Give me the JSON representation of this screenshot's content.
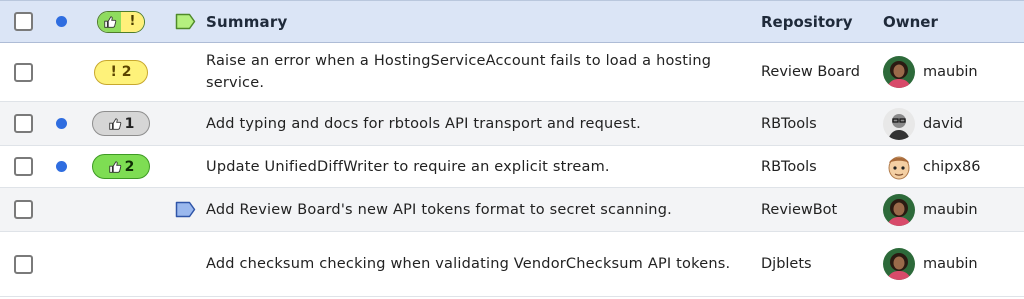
{
  "header": {
    "summary": "Summary",
    "repository": "Repository",
    "owner": "Owner",
    "ship_it_issue_mark": "!"
  },
  "rows": [
    {
      "new_updates": false,
      "badge": {
        "type": "issue",
        "text": "! 2"
      },
      "draft_flag": false,
      "summary": "Raise an error when a HostingServiceAccount fails to load a hosting service.",
      "repository": "Review Board",
      "owner": "maubin",
      "avatar": "woman-avatar"
    },
    {
      "new_updates": true,
      "badge": {
        "type": "ship-gray",
        "count": "1"
      },
      "draft_flag": false,
      "summary": "Add typing and docs for rbtools API transport and request.",
      "repository": "RBTools",
      "owner": "david",
      "avatar": "man-glasses-avatar"
    },
    {
      "new_updates": true,
      "badge": {
        "type": "ship-green",
        "count": "2"
      },
      "draft_flag": false,
      "summary": "Update UnifiedDiffWriter to require an explicit stream.",
      "repository": "RBTools",
      "owner": "chipx86",
      "avatar": "cartoon-avatar"
    },
    {
      "new_updates": false,
      "badge": null,
      "draft_flag": true,
      "summary": "Add Review Board's new API tokens format to secret scanning.",
      "repository": "ReviewBot",
      "owner": "maubin",
      "avatar": "woman-avatar"
    },
    {
      "new_updates": false,
      "badge": null,
      "draft_flag": false,
      "summary": "Add checksum checking when validating VendorChecksum API tokens.",
      "repository": "Djblets",
      "owner": "maubin",
      "avatar": "woman-avatar"
    }
  ],
  "colors": {
    "header_bg": "#dbe5f6",
    "new_dot": "#2f6de0",
    "issue_pill": "#fef27a",
    "ship_green": "#7edd53",
    "ship_gray": "#d6d6d6",
    "flag_blue": "#9ab8ee",
    "flag_green": "#b5f07f"
  }
}
